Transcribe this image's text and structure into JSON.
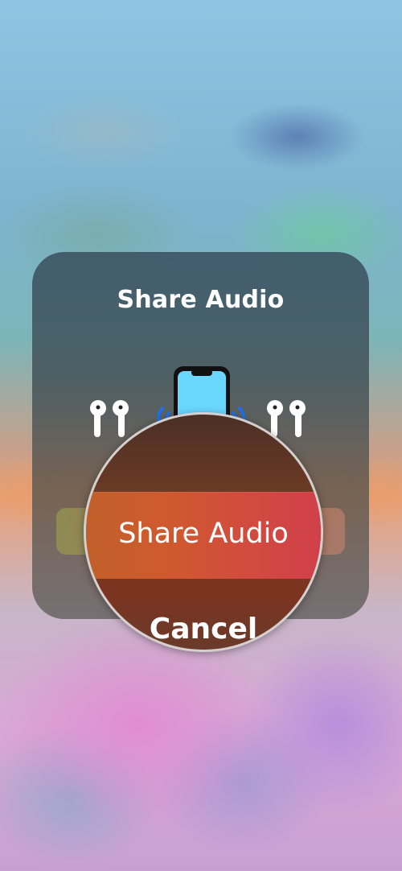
{
  "sheet": {
    "title": "Share Audio",
    "primary_button": "Share Audio",
    "cancel_button": "Cancel"
  },
  "icons": {
    "left_device": "airpods-icon",
    "center_device": "iphone-icon",
    "right_device": "airpods-icon"
  },
  "colors": {
    "share_button": "#d04a3c",
    "wave_blue": "#1f6fe5",
    "phone_screen": "#6ad7ff"
  }
}
